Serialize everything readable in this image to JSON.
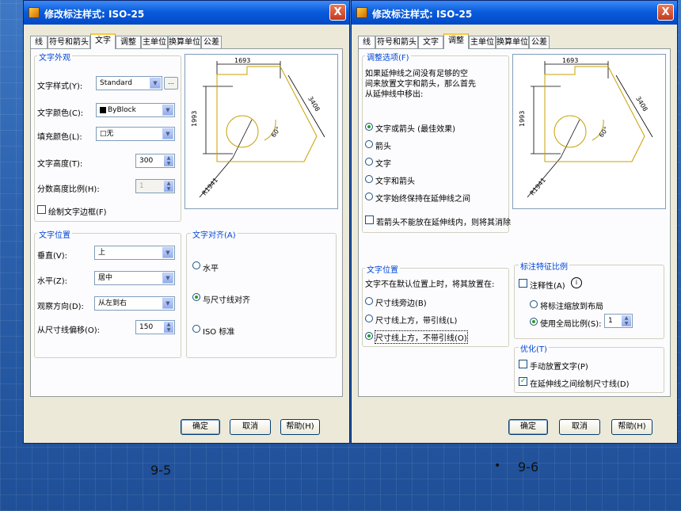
{
  "left": {
    "title": "修改标注样式: ISO-25",
    "close": "X",
    "tabs": [
      "线",
      "符号和箭头",
      "文字",
      "调整",
      "主单位",
      "换算单位",
      "公差"
    ],
    "active_tab": "文字",
    "appearance": {
      "label": "文字外观",
      "style_label": "文字样式(Y):",
      "style_value": "Standard",
      "ellipsis": "...",
      "color_label": "文字颜色(C):",
      "color_value": "ByBlock",
      "fill_label": "填充颜色(L):",
      "fill_value": "□无",
      "height_label": "文字高度(T):",
      "height_value": "300",
      "fraction_label": "分数高度比例(H):",
      "fraction_value": "1",
      "frame_label": "绘制文字边框(F)"
    },
    "placement": {
      "label": "文字位置",
      "vertical_label": "垂直(V):",
      "vertical_value": "上",
      "horizontal_label": "水平(Z):",
      "horizontal_value": "居中",
      "view_label": "观察方向(D):",
      "view_value": "从左到右",
      "offset_label": "从尺寸线偏移(O):",
      "offset_value": "150"
    },
    "alignment": {
      "label": "文字对齐(A)",
      "options": [
        "水平",
        "与尺寸线对齐",
        "ISO 标准"
      ],
      "selected": 1
    },
    "buttons": {
      "ok": "确定",
      "cancel": "取消",
      "help": "帮助(H)"
    },
    "caption": "9-5"
  },
  "right": {
    "title": "修改标注样式: ISO-25",
    "close": "X",
    "tabs": [
      "线",
      "符号和箭头",
      "文字",
      "调整",
      "主单位",
      "换算单位",
      "公差"
    ],
    "active_tab": "调整",
    "fit": {
      "label": "调整选项(F)",
      "desc": [
        "如果延伸线之间没有足够的空",
        "间来放置文字和箭头，那么首先",
        "从延伸线中移出:"
      ],
      "options": [
        "文字或箭头 (最佳效果)",
        "箭头",
        "文字",
        "文字和箭头",
        "文字始终保持在延伸线之间"
      ],
      "selected": 0,
      "suppress_label": "若箭头不能放在延伸线内，则将其消除"
    },
    "textpos": {
      "label": "文字位置",
      "desc": "文字不在默认位置上时，将其放置在:",
      "options": [
        "尺寸线旁边(B)",
        "尺寸线上方，带引线(L)",
        "尺寸线上方，不带引线(O)"
      ],
      "selected": 2
    },
    "scale": {
      "label": "标注特征比例",
      "annotative_label": "注释性(A)",
      "info_icon": "i",
      "layout_label": "将标注缩放到布局",
      "global_label": "使用全局比例(S):",
      "global_value": "1"
    },
    "fine": {
      "label": "优化(T)",
      "manual_label": "手动放置文字(P)",
      "draw_label": "在延伸线之间绘制尺寸线(D)",
      "check_mark": "✓"
    },
    "buttons": {
      "ok": "确定",
      "cancel": "取消",
      "help": "帮助(H)"
    },
    "caption": "9-6",
    "bullet": "•"
  },
  "preview": {
    "dim_top": "1693",
    "dim_left": "1993",
    "dim_right": "3408",
    "angle": "60°",
    "radius": "R1941"
  },
  "colors": {
    "titlebar": "#0a5ddc",
    "dialog": "#ece9d8",
    "accent_blue": "#0046d5",
    "radio_green": "#21a121",
    "drawing_lines": "#c8a000",
    "background": "#2a5ea8"
  }
}
